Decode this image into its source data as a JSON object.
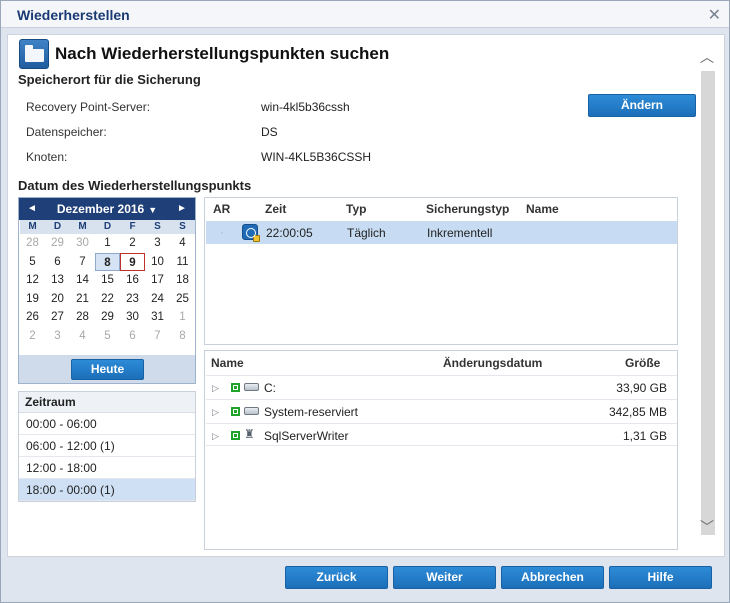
{
  "window": {
    "title": "Wiederherstellen",
    "close_symbol": "✕"
  },
  "header": {
    "title": "Nach Wiederherstellungspunkten suchen"
  },
  "backup_location": {
    "section_title": "Speicherort für die Sicherung",
    "rows": [
      {
        "label": "Recovery Point-Server:",
        "value": "win-4kl5b36cssh"
      },
      {
        "label": "Datenspeicher:",
        "value": "DS"
      },
      {
        "label": "Knoten:",
        "value": "WIN-4KL5B36CSSH"
      }
    ],
    "change_button": "Ändern"
  },
  "recovery_date": {
    "section_title": "Datum des Wiederherstellungspunkts"
  },
  "calendar": {
    "month_label": "Dezember 2016",
    "prev_symbol": "◄",
    "next_symbol": "►",
    "dropdown_symbol": "▼",
    "weekdays": [
      "M",
      "D",
      "M",
      "D",
      "F",
      "S",
      "S"
    ],
    "weeks": [
      [
        {
          "d": "28",
          "o": true
        },
        {
          "d": "29",
          "o": true
        },
        {
          "d": "30",
          "o": true
        },
        {
          "d": "1"
        },
        {
          "d": "2"
        },
        {
          "d": "3"
        },
        {
          "d": "4"
        }
      ],
      [
        {
          "d": "5"
        },
        {
          "d": "6"
        },
        {
          "d": "7"
        },
        {
          "d": "8",
          "sel": true
        },
        {
          "d": "9",
          "today": true
        },
        {
          "d": "10"
        },
        {
          "d": "11"
        }
      ],
      [
        {
          "d": "12"
        },
        {
          "d": "13"
        },
        {
          "d": "14"
        },
        {
          "d": "15"
        },
        {
          "d": "16"
        },
        {
          "d": "17"
        },
        {
          "d": "18"
        }
      ],
      [
        {
          "d": "19"
        },
        {
          "d": "20"
        },
        {
          "d": "21"
        },
        {
          "d": "22"
        },
        {
          "d": "23"
        },
        {
          "d": "24"
        },
        {
          "d": "25"
        }
      ],
      [
        {
          "d": "26"
        },
        {
          "d": "27"
        },
        {
          "d": "28"
        },
        {
          "d": "29"
        },
        {
          "d": "30"
        },
        {
          "d": "31"
        },
        {
          "d": "1",
          "o": true
        }
      ],
      [
        {
          "d": "2",
          "o": true
        },
        {
          "d": "3",
          "o": true
        },
        {
          "d": "4",
          "o": true
        },
        {
          "d": "5",
          "o": true
        },
        {
          "d": "6",
          "o": true
        },
        {
          "d": "7",
          "o": true
        },
        {
          "d": "8",
          "o": true
        }
      ]
    ],
    "today_button": "Heute"
  },
  "time_period": {
    "title": "Zeitraum",
    "items": [
      {
        "label": "00:00 - 06:00",
        "selected": false
      },
      {
        "label": "06:00 - 12:00   (1)",
        "selected": false
      },
      {
        "label": "12:00 - 18:00",
        "selected": false
      },
      {
        "label": "18:00 - 00:00   (1)",
        "selected": true
      }
    ]
  },
  "recovery_points": {
    "headers": {
      "ar": "AR",
      "time": "Zeit",
      "type": "Typ",
      "backup_type": "Sicherungstyp",
      "name": "Name"
    },
    "rows": [
      {
        "time": "22:00:05",
        "type": "Täglich",
        "backup_type": "Inkrementell",
        "name": ""
      }
    ]
  },
  "contents": {
    "headers": {
      "name": "Name",
      "modified": "Änderungsdatum",
      "size": "Größe"
    },
    "rows": [
      {
        "name": "C:",
        "modified": "",
        "size": "33,90 GB",
        "icon": "drive-icon"
      },
      {
        "name": "System-reserviert",
        "modified": "",
        "size": "342,85 MB",
        "icon": "drive-icon"
      },
      {
        "name": "SqlServerWriter",
        "modified": "",
        "size": "1,31 GB",
        "icon": "sql-writer-icon"
      }
    ]
  },
  "footer": {
    "back": "Zurück",
    "next": "Weiter",
    "cancel": "Abbrechen",
    "help": "Hilfe"
  },
  "colors": {
    "accent": "#1f72bd",
    "header_dark": "#1e3f77",
    "selection": "#c7dcf2",
    "status_ok": "#1fa32c"
  }
}
